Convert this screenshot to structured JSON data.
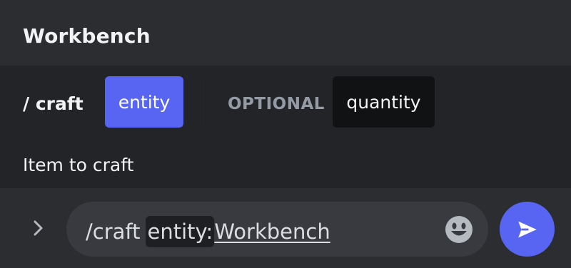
{
  "header": {
    "title": "Workbench"
  },
  "command": {
    "name": "/ craft",
    "required_param": "entity",
    "optional_label": "OPTIONAL",
    "optional_param": "quantity",
    "param_description": "Item to craft"
  },
  "composer": {
    "command_prefix": "/craft",
    "token_key": "entity:",
    "token_value": "Workbench",
    "expand_icon": "chevron-right-icon",
    "emoji_icon": "smiley-icon",
    "send_icon": "send-icon"
  },
  "colors": {
    "accent": "#5865f2",
    "background": "#2b2d31",
    "panel": "#232428",
    "input": "#383a40",
    "muted_text": "#949ba4"
  }
}
